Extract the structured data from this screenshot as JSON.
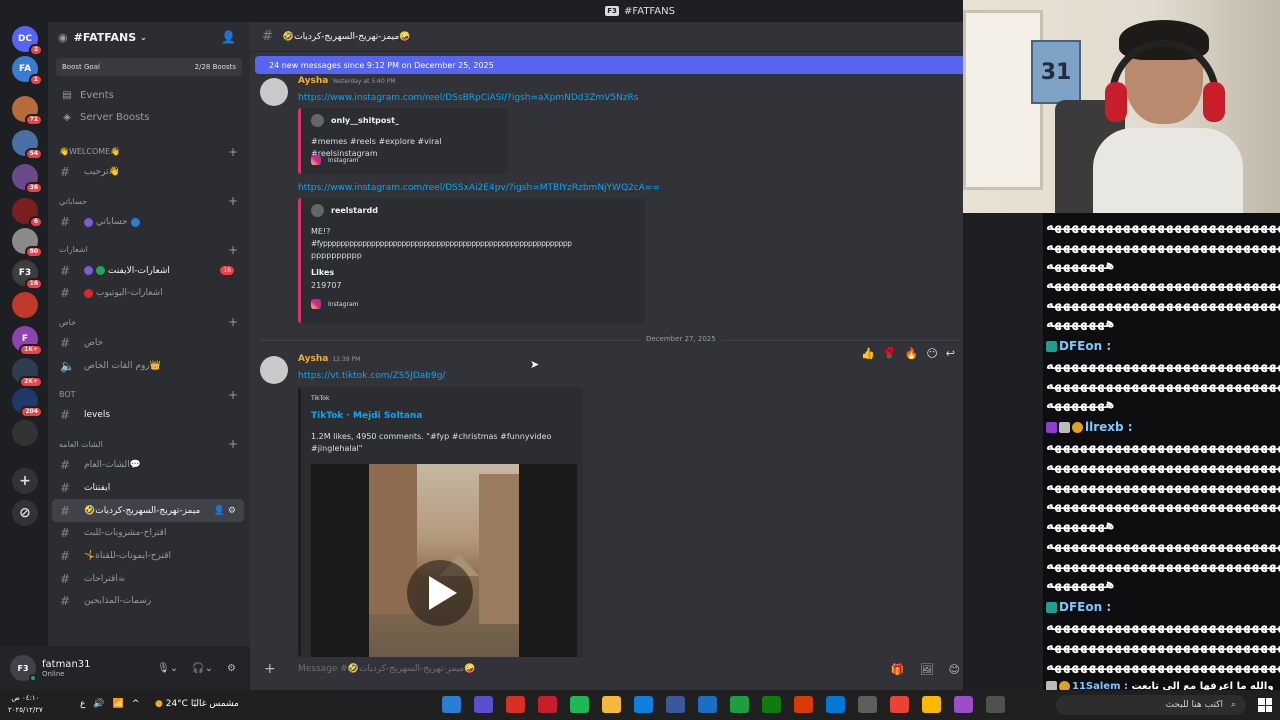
{
  "window": {
    "title": "#FATFANS"
  },
  "rail": {
    "servers": [
      {
        "label": "DC",
        "color": "#5865f2",
        "badge": "2"
      },
      {
        "label": "FA",
        "color": "#3a7bd5",
        "badge": "1"
      },
      {
        "label": "",
        "color": "#b56b3a",
        "badge": "71"
      },
      {
        "label": "",
        "color": "#4a6fa5",
        "badge": "54"
      },
      {
        "label": "",
        "color": "#6a4a8a",
        "badge": "36"
      },
      {
        "label": "",
        "color": "#7a1f1f",
        "badge": "6"
      },
      {
        "label": "",
        "color": "#8a8a8a",
        "badge": "80"
      },
      {
        "label": "F3",
        "color": "#3d3d3d",
        "badge": "16"
      },
      {
        "label": "",
        "color": "#c0392b",
        "badge": ""
      },
      {
        "label": "F",
        "color": "#8e44ad",
        "badge": "1K+"
      },
      {
        "label": "",
        "color": "#2c3e50",
        "badge": "2K+"
      },
      {
        "label": "",
        "color": "#1f3a6a",
        "badge": "204"
      },
      {
        "label": "",
        "color": "#333",
        "badge": ""
      }
    ],
    "add_server": "+",
    "discover": "⊘"
  },
  "sidebar": {
    "guild_name": "#FATFANS",
    "boost_goal": "Boost Goal",
    "boost_count": "2/28 Boosts",
    "events": "Events",
    "server_boosts": "Server Boosts",
    "categories": {
      "welcome": "👋WELCOME👋",
      "accounts": "حساباتي",
      "notifications": "اشعارات",
      "private": "خاص",
      "bot": "BOT",
      "general": "الشات العامه"
    },
    "channels": {
      "welcome": "ترحيب👋",
      "my_accounts": "حساباتي",
      "kick_notif": "اشعارات-الايفنت",
      "youtube_notif": "اشعارات-اليوتيوب",
      "private": "خاص",
      "room": "روم القات الخاص👑",
      "levels": "levels",
      "general_chat": "الشات-العام💬",
      "events": "ايفنتات",
      "memes": "🤣ميمز-تهريج-السهريج-كرديات",
      "suggest_drinks": "اقتراح-مشروبات-للبث",
      "suggest_emotes": "🤸اقترح-ايموتات-للقناة",
      "suggestions": "اقتراحات☕",
      "artists": "رسمات-المذابحين"
    },
    "notif_count": "16"
  },
  "user": {
    "name": "fatman31",
    "status": "Online",
    "avatar": "F3"
  },
  "chat": {
    "channel_title": "🤣ميمز-تهريج-السهريج-كرديات🤪",
    "new_messages": "24 new messages since 9:12 PM on December 25, 2025",
    "msg1": {
      "author": "Aysha",
      "time": "Yesterday at 5:40 PM",
      "link1": "https://www.instagram.com/reel/DSsBRpCiASI/?igsh=aXpmNDd3ZmV5NzRs",
      "embed1_author": "only__shitpost_",
      "embed1_text": "#memes #reels #explore #viral #reelsinstagram",
      "embed1_footer": "Instagram",
      "link2": "https://www.instagram.com/reel/DSSxAi2E4pv/?igsh=MTBlYzRzbmNjYWQ2cA==",
      "embed2_author": "reelstardd",
      "embed2_line1": "ME!?",
      "embed2_line2": "#fyppppppppppppppppppppppppppppppppppppppppppppppppppppppppp",
      "embed2_line3": "pppppppppp",
      "embed2_likes_label": "Likes",
      "embed2_likes": "219707",
      "embed2_footer": "Instagram"
    },
    "date_divider": "December 27, 2025",
    "msg2": {
      "author": "Aysha",
      "time": "12:39 PM",
      "link": "https://vt.tiktok.com/ZS5JDab9g/",
      "provider": "TikTok",
      "title": "TikTok · Mejdi Soltana",
      "desc": "1.2M likes, 4950 comments. \"#fyp #christmas #funnyvideo #jinglehalal\""
    },
    "reactions": [
      "👍",
      "🌹",
      "🔥",
      "😶",
      "↩"
    ],
    "composer_placeholder": "Message #🤣ميمز-تهريج-السهريج-كرديات🤪",
    "composer_tools": [
      "🎁",
      "🖼",
      "😊"
    ]
  },
  "overlay": {
    "spam": "ههههههههههههههههههههههههههههه",
    "spam_short": "هههههههه",
    "users": [
      {
        "name": "DFEon :",
        "color": "#7ec8ff"
      },
      {
        "name": "llrexb :",
        "color": "#7ec8ff"
      },
      {
        "name": "DFEon :",
        "color": "#7ec8ff"
      },
      {
        "name": "11Salem :",
        "color": "#7ec8ff"
      }
    ],
    "last_msg": "والله ما اعرفها مع الي تابعت"
  },
  "taskbar": {
    "time": "٠٤:١٠ ص",
    "date": "٢٠٢٥/١٢/٢٧",
    "weather": "24°C مشمس غالبًا",
    "search_placeholder": "اكتب هنا للبحث",
    "icons": [
      "#2a7fd4",
      "#5a4fcf",
      "#d93025",
      "#c81e2a",
      "#1db954",
      "#f6b93b",
      "#0f7fe0",
      "#3b5998",
      "#1b6ec2",
      "#1e9e3e",
      "#107c10",
      "#d83b01",
      "#0078d4",
      "#5e5e5e",
      "#ea4335",
      "#ffb900",
      "#9b4dca",
      "#505050"
    ],
    "tray": [
      "ع",
      "🔊",
      "📶",
      "^"
    ]
  },
  "colors": {
    "blurple": "#5865f2",
    "author": "#f0b232",
    "link": "#00a8fc"
  }
}
